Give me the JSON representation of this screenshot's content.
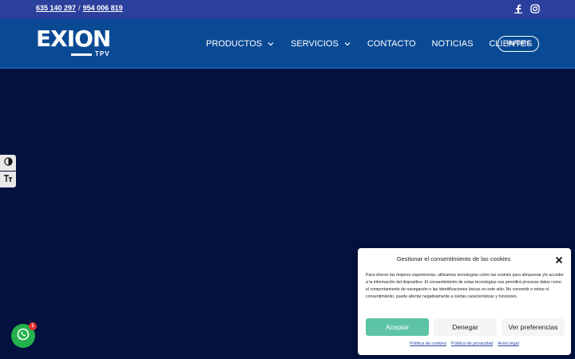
{
  "topbar": {
    "phone_1": "635 140 297",
    "separator": "/",
    "phone_2": "954 006 819",
    "social_icons": [
      "facebook-icon",
      "instagram-icon"
    ]
  },
  "header": {
    "logo_text": "EXION",
    "logo_subtext": "TPV",
    "nav": [
      {
        "label": "PRODUCTOS",
        "has_dropdown": true
      },
      {
        "label": "SERVICIOS",
        "has_dropdown": true
      },
      {
        "label": "CONTACTO",
        "has_dropdown": false
      },
      {
        "label": "NOTICIAS",
        "has_dropdown": false
      },
      {
        "label": "CLIENTES",
        "has_dropdown": false
      }
    ],
    "support_button": "SOPORTE"
  },
  "accessibility": {
    "icons": [
      "contrast-toggle-icon",
      "font-size-icon"
    ]
  },
  "whatsapp": {
    "badge_count": "1"
  },
  "cookie_banner": {
    "title": "Gestionar el consentimiento de las cookies",
    "body": "Para ofrecer las mejores experiencias, utilizamos tecnologías como las cookies para almacenar y/o acceder a la información del dispositivo. El consentimiento de estas tecnologías nos permitirá procesar datos como el comportamiento de navegación o las identificaciones únicas en este sitio. No consentir o retirar el consentimiento, puede afectar negativamente a ciertas características y funciones.",
    "accept": "Aceptar",
    "deny": "Denegar",
    "preferences": "Ver preferencias",
    "links": [
      "Política de cookies",
      "Política de privacidad",
      "Aviso legal"
    ]
  },
  "colors": {
    "topbar_bg": "#2b3f9c",
    "header_bg": "#0a4a95",
    "hero_bg": "#03113f",
    "accept_bg": "#5cc4a5",
    "whatsapp_green": "#22b14c"
  }
}
